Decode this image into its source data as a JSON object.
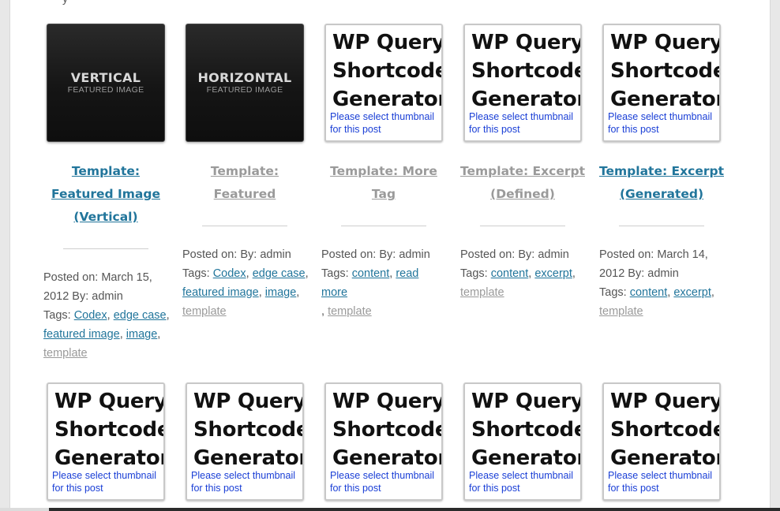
{
  "top_partial_text": "y",
  "thumb_generic": {
    "title_lines": [
      "WP Query",
      "Shortcode",
      "Generator"
    ],
    "note_lines": [
      "Please select thumbnail",
      "for this post"
    ]
  },
  "thumb_vertical": {
    "big": "VERTICAL",
    "small": "FEATURED IMAGE"
  },
  "thumb_horizontal": {
    "big": "HORIZONTAL",
    "small": "FEATURED IMAGE"
  },
  "posts": [
    {
      "title_lines": [
        "Template:",
        "Featured Image",
        "(Vertical)"
      ],
      "meta_lines": [
        "Posted on: March 15,",
        "2012 By: admin"
      ],
      "tags_label": "Tags:",
      "tags": [
        "Codex",
        "edge case",
        "featured image",
        "image",
        "template"
      ]
    },
    {
      "title_lines": [
        "Template:",
        "Featured"
      ],
      "meta_lines": [
        "Posted on: By: admin"
      ],
      "tags_label": "Tags:",
      "tags": [
        "Codex",
        "edge case",
        "featured image",
        "image",
        "template"
      ]
    },
    {
      "title_lines": [
        "Template: More",
        "Tag"
      ],
      "meta_lines": [
        "Posted on: By: admin"
      ],
      "tags_label": "Tags:",
      "tags": [
        "content",
        "read more",
        "template"
      ]
    },
    {
      "title_lines": [
        "Template: Excerpt",
        "(Defined)"
      ],
      "meta_lines": [
        "Posted on: By: admin"
      ],
      "tags_label": "Tags:",
      "tags": [
        "content",
        "excerpt",
        "template"
      ]
    },
    {
      "title_lines": [
        "Template: Excerpt",
        "(Generated)"
      ],
      "meta_lines": [
        "Posted on: March 14,",
        "2012 By: admin"
      ],
      "tags_label": "Tags:",
      "tags": [
        "content",
        "excerpt",
        "template"
      ]
    }
  ],
  "colors": {
    "link": "#21759b",
    "link_visited": "#9a9a9a",
    "note": "#1a3fd6",
    "text": "#555555"
  }
}
